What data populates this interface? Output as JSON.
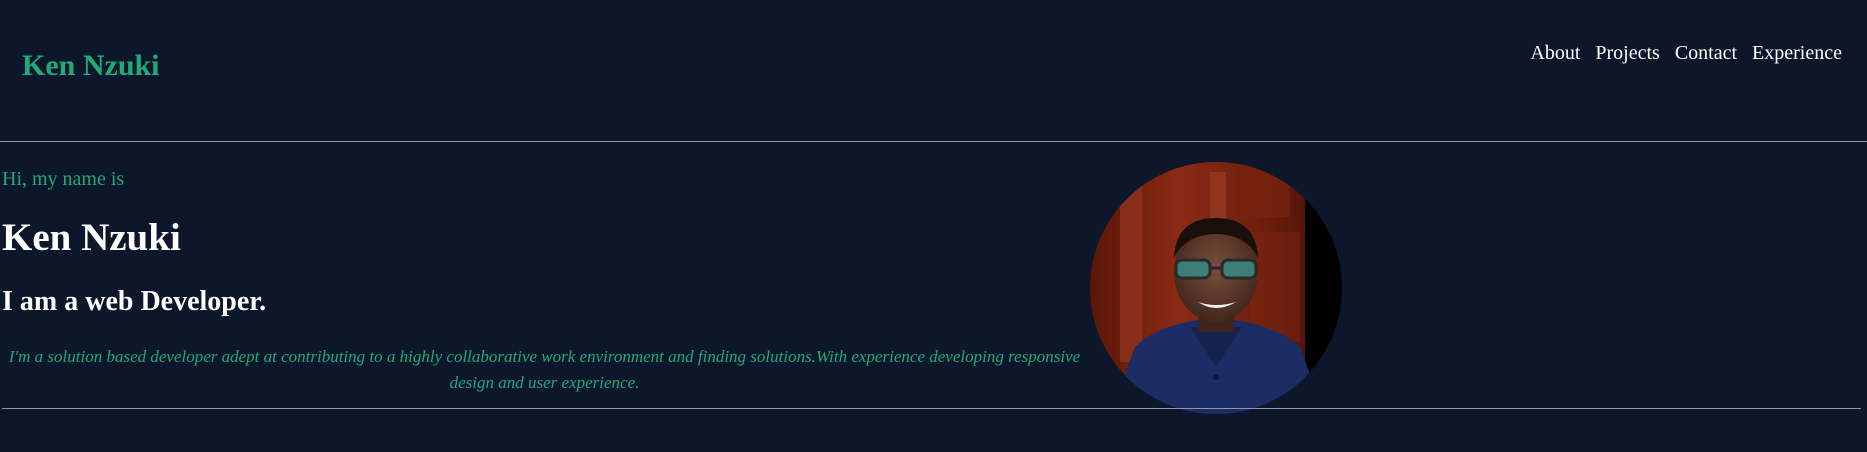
{
  "header": {
    "brand": "Ken Nzuki",
    "nav": [
      {
        "label": "About"
      },
      {
        "label": "Projects"
      },
      {
        "label": "Contact"
      },
      {
        "label": "Experience"
      }
    ]
  },
  "hero": {
    "greeting": "Hi, my name is",
    "name": "Ken Nzuki",
    "role": "I am a web Developer.",
    "description": "I'm a solution based developer adept at contributing to a highly collaborative work environment and finding solutions.With experience developing responsive design and user experience."
  },
  "colors": {
    "background": "#0d172b",
    "accent": "#1faa77",
    "text": "#ffffff",
    "divider": "#8f97a6"
  }
}
